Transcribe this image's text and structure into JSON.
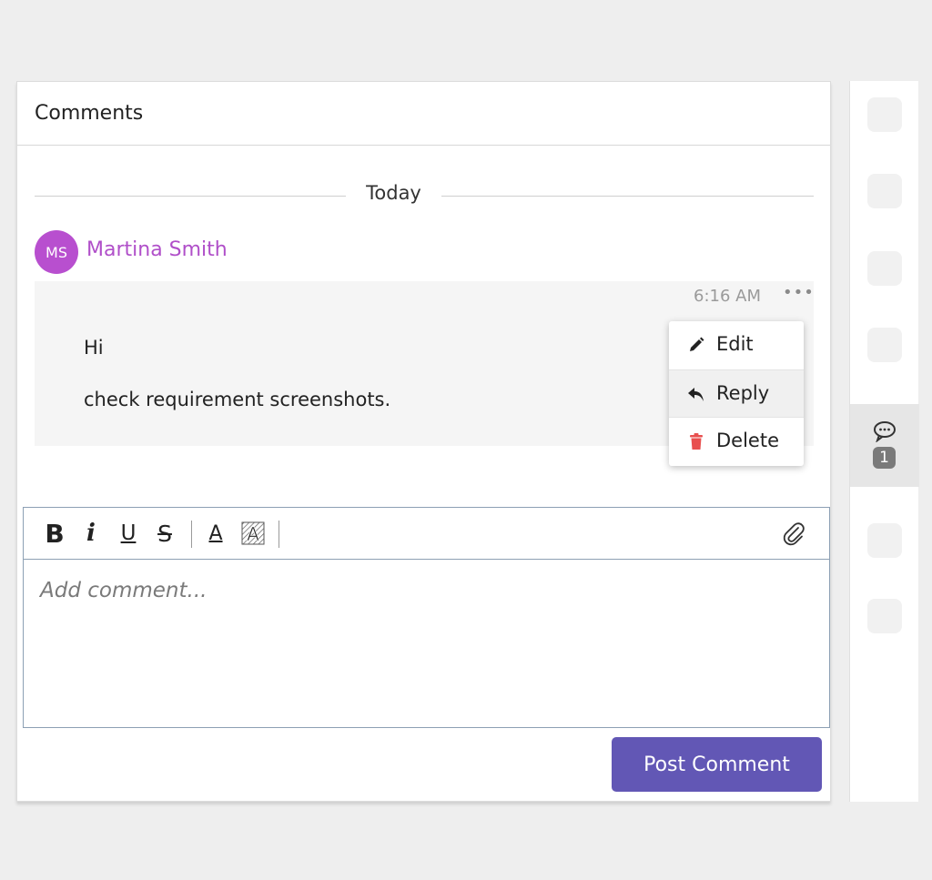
{
  "panel": {
    "title": "Comments",
    "day_divider": "Today"
  },
  "comment": {
    "author_initials": "MS",
    "author_name": "Martina Smith",
    "time": "6:16 AM",
    "more_icon": "•••",
    "lines": [
      "Hi",
      "check requirement screenshots."
    ]
  },
  "context_menu": {
    "items": [
      {
        "label": "Edit",
        "icon": "pencil-icon"
      },
      {
        "label": "Reply",
        "icon": "reply-icon"
      },
      {
        "label": "Delete",
        "icon": "trash-icon"
      }
    ]
  },
  "editor": {
    "toolbar": {
      "bold": "B",
      "italic": "i",
      "underline": "U",
      "strike": "S",
      "font_color": "A",
      "highlight": "A"
    },
    "placeholder": "Add comment..."
  },
  "post_button": "Post Comment",
  "side_rail": {
    "comments_count": "1"
  },
  "colors": {
    "accent": "#6257b5",
    "author": "#b04fc9",
    "avatar": "#b84fcf",
    "delete_icon": "#e8504f"
  }
}
